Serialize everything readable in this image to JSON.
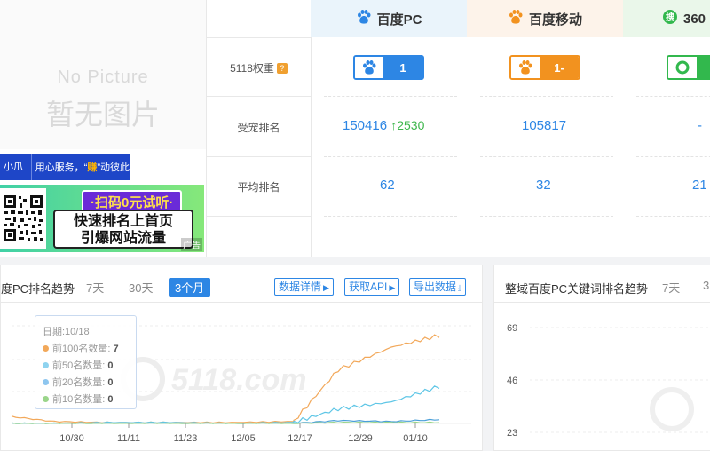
{
  "left": {
    "nopic_en": "No Picture",
    "nopic_cn": "暂无图片",
    "banner1_a": "小爪交易",
    "banner1_b": "用心服务，“",
    "banner1_hl": "赚",
    "banner1_c": "”动彼此",
    "banner2_promo": "·扫码0元试听·",
    "banner2_line1": "快速排名上首页",
    "banner2_line2": "引爆网站流量",
    "banner2_ad": "广告"
  },
  "table": {
    "columns": [
      {
        "name": "百度PC",
        "icon": "baidu-paw-icon",
        "color": "#2d86e4"
      },
      {
        "name": "百度移动",
        "icon": "baidu-paw-icon",
        "color": "#f2921f"
      },
      {
        "name": "360",
        "icon": "360-search-icon",
        "color": "#32b84d"
      }
    ],
    "row_weight_label": "5118权重",
    "row_weight_help": "?",
    "row_pet_label": "受宠排名",
    "row_avg_label": "平均排名",
    "weights": [
      "1",
      "1-",
      ""
    ],
    "pet_rank": {
      "pc": "150416",
      "pc_change": "2530",
      "mobile": "105817",
      "s360": "-"
    },
    "avg_rank": {
      "pc": "62",
      "mobile": "32",
      "s360": "21"
    }
  },
  "left_chart": {
    "title": "度PC排名趋势",
    "ranges": [
      "7天",
      "30天",
      "3个月"
    ],
    "active_range": "3个月",
    "actions": [
      "数据详情",
      "获取API",
      "导出数据"
    ],
    "tooltip": {
      "date_label": "日期:10/18",
      "rows": [
        {
          "label": "前100名数量:",
          "value": "7",
          "color": "#f2a85a"
        },
        {
          "label": "前50名数量:",
          "value": "0",
          "color": "#8ed3ef"
        },
        {
          "label": "前20名数量:",
          "value": "0",
          "color": "#8ec6ef"
        },
        {
          "label": "前10名数量:",
          "value": "0",
          "color": "#9ad58a"
        }
      ]
    },
    "watermark": "5118.com"
  },
  "right_chart": {
    "title": "整域百度PC关键词排名趋势",
    "ranges": [
      "7天",
      "3"
    ]
  },
  "chart_data": [
    {
      "type": "line",
      "title": "",
      "x": [
        "10/30",
        "11/11",
        "11/23",
        "12/05",
        "12/17",
        "12/29",
        "01/10"
      ],
      "series": [
        {
          "name": "前100名数量",
          "color": "#f2a85a",
          "values": [
            7,
            2,
            1,
            1,
            1,
            2,
            55,
            78,
            90
          ]
        },
        {
          "name": "前50名数量",
          "color": "#5ec6e6",
          "values": [
            0,
            0,
            1,
            1,
            0,
            1,
            15,
            22,
            38
          ]
        },
        {
          "name": "前20名数量",
          "color": "#4a9fd8",
          "values": [
            0,
            0,
            0,
            0,
            0,
            0,
            3,
            2,
            4
          ]
        },
        {
          "name": "前10名数量",
          "color": "#9ad58a",
          "values": [
            0,
            0,
            0,
            0,
            0,
            0,
            1,
            1,
            1
          ]
        }
      ]
    },
    {
      "type": "line",
      "title": "",
      "y_ticks": [
        "69",
        "46",
        "23"
      ],
      "series": []
    }
  ]
}
